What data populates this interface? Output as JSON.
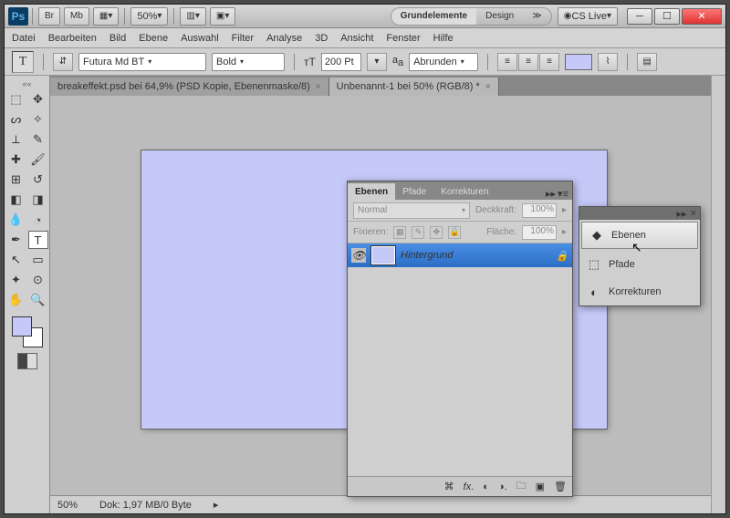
{
  "title": {
    "ps": "Ps",
    "br": "Br",
    "mb": "Mb",
    "zoom": "50%",
    "ws1": "Grundelemente",
    "ws2": "Design",
    "cs": "CS Live"
  },
  "menu": [
    "Datei",
    "Bearbeiten",
    "Bild",
    "Ebene",
    "Auswahl",
    "Filter",
    "Analyse",
    "3D",
    "Ansicht",
    "Fenster",
    "Hilfe"
  ],
  "opt": {
    "font": "Futura Md BT",
    "weight": "Bold",
    "size": "200 Pt",
    "aa": "Abrunden"
  },
  "tabs": {
    "t1": "breakeffekt.psd bei 64,9% (PSD Kopie, Ebenenmaske/8)",
    "t2": "Unbenannt-1 bei 50% (RGB/8) *"
  },
  "layers": {
    "tab1": "Ebenen",
    "tab2": "Pfade",
    "tab3": "Korrekturen",
    "mode": "Normal",
    "opLbl": "Deckkraft:",
    "op": "100%",
    "lockLbl": "Fixieren:",
    "fillLbl": "Fläche:",
    "fill": "100%",
    "bg": "Hintergrund"
  },
  "fly": {
    "i1": "Ebenen",
    "i2": "Pfade",
    "i3": "Korrekturen"
  },
  "status": {
    "zoom": "50%",
    "doc": "Dok: 1,97 MB/0 Byte"
  }
}
